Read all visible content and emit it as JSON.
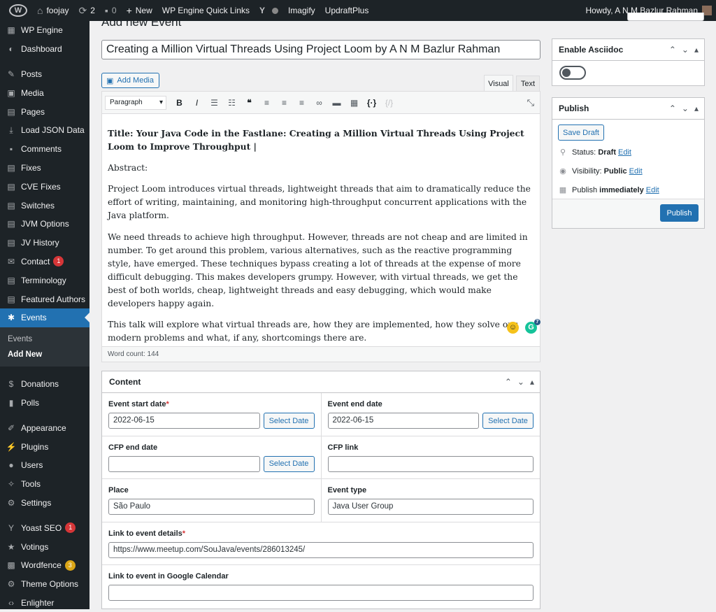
{
  "adminbar": {
    "site": "foojay",
    "updates": "2",
    "comments": "0",
    "new": "New",
    "quick_links": "WP Engine Quick Links",
    "imagify": "Imagify",
    "updraft": "UpdraftPlus",
    "howdy": "Howdy, A N M Bazlur Rahman"
  },
  "sidebar": {
    "items": [
      {
        "label": "WP Engine",
        "icon": "wpengine-icon"
      },
      {
        "label": "Dashboard",
        "icon": "dashboard-icon"
      },
      {
        "label": "Posts",
        "icon": "pin-icon"
      },
      {
        "label": "Media",
        "icon": "media-icon"
      },
      {
        "label": "Pages",
        "icon": "pages-icon"
      },
      {
        "label": "Load JSON Data",
        "icon": "download-icon"
      },
      {
        "label": "Comments",
        "icon": "comment-icon"
      },
      {
        "label": "Fixes",
        "icon": "table-icon"
      },
      {
        "label": "CVE Fixes",
        "icon": "table-icon"
      },
      {
        "label": "Switches",
        "icon": "table-icon"
      },
      {
        "label": "JVM Options",
        "icon": "table-icon"
      },
      {
        "label": "JV History",
        "icon": "table-icon"
      },
      {
        "label": "Contact",
        "icon": "mail-icon",
        "badge": "1"
      },
      {
        "label": "Terminology",
        "icon": "table-icon"
      },
      {
        "label": "Featured Authors",
        "icon": "table-icon"
      },
      {
        "label": "Events",
        "icon": "groups-icon"
      }
    ],
    "sub": [
      "Events",
      "Add New"
    ],
    "items2": [
      {
        "label": "Donations",
        "icon": "dollar-icon"
      },
      {
        "label": "Polls",
        "icon": "chart-icon"
      },
      {
        "label": "Appearance",
        "icon": "brush-icon"
      },
      {
        "label": "Plugins",
        "icon": "plug-icon"
      },
      {
        "label": "Users",
        "icon": "user-icon"
      },
      {
        "label": "Tools",
        "icon": "wrench-icon"
      },
      {
        "label": "Settings",
        "icon": "settings-icon"
      },
      {
        "label": "Yoast SEO",
        "icon": "yoast-icon",
        "badge": "1"
      },
      {
        "label": "Votings",
        "icon": "star-icon"
      },
      {
        "label": "Wordfence",
        "icon": "wordfence-icon",
        "badge": "3"
      },
      {
        "label": "Theme Options",
        "icon": "gear-icon"
      },
      {
        "label": "Enlighter",
        "icon": "code-icon"
      }
    ]
  },
  "page": {
    "title": "Add new Event",
    "post_title": "Creating a Million Virtual Threads Using Project Loom by A N M Bazlur Rahman"
  },
  "editor": {
    "add_media": "Add Media",
    "tab_visual": "Visual",
    "tab_text": "Text",
    "format": "Paragraph",
    "title_line": "Title: Your Java Code in the Fastlane: Creating a Million Virtual Threads Using Project Loom to Improve Throughput |",
    "paragraphs": [
      "Abstract:",
      "Project Loom introduces virtual threads, lightweight threads that aim to dramatically reduce the effort of writing, maintaining, and monitoring high-throughput concurrent applications with the Java platform.",
      "We need threads to achieve high throughput. However, threads are not cheap and are limited in number. To get around this problem, various alternatives, such as the reactive programming style, have emerged. These techniques bypass creating a lot of threads at the expense of more difficult debugging. This makes developers grumpy. However, with virtual threads, we get the best of both worlds, cheap, lightweight threads and easy debugging, which would make developers happy again.",
      "This talk will explore what virtual threads are, how they are implemented, how they solve our modern problems and what, if any, shortcomings there are."
    ],
    "word_count": "Word count: 144",
    "grammarly_count": "7"
  },
  "content_box": {
    "title": "Content",
    "start_label": "Event start date",
    "start_value": "2022-06-15",
    "end_label": "Event end date",
    "end_value": "2022-06-15",
    "select_date": "Select Date",
    "cfp_end_label": "CFP end date",
    "cfp_end_value": "",
    "cfp_link_label": "CFP link",
    "cfp_link_value": "",
    "place_label": "Place",
    "place_value": "São Paulo",
    "type_label": "Event type",
    "type_value": "Java User Group",
    "link_label": "Link to event details",
    "link_value": "https://www.meetup.com/SouJava/events/286013245/",
    "gcal_label": "Link to event in Google Calendar",
    "gcal_value": "",
    "required": "*"
  },
  "asciidoc": {
    "title": "Enable Asciidoc"
  },
  "publish": {
    "title": "Publish",
    "save_draft": "Save Draft",
    "status_label": "Status:",
    "status_value": "Draft",
    "visibility_label": "Visibility:",
    "visibility_value": "Public",
    "publish_label": "Publish",
    "publish_value": "immediately",
    "edit": "Edit",
    "button": "Publish"
  }
}
